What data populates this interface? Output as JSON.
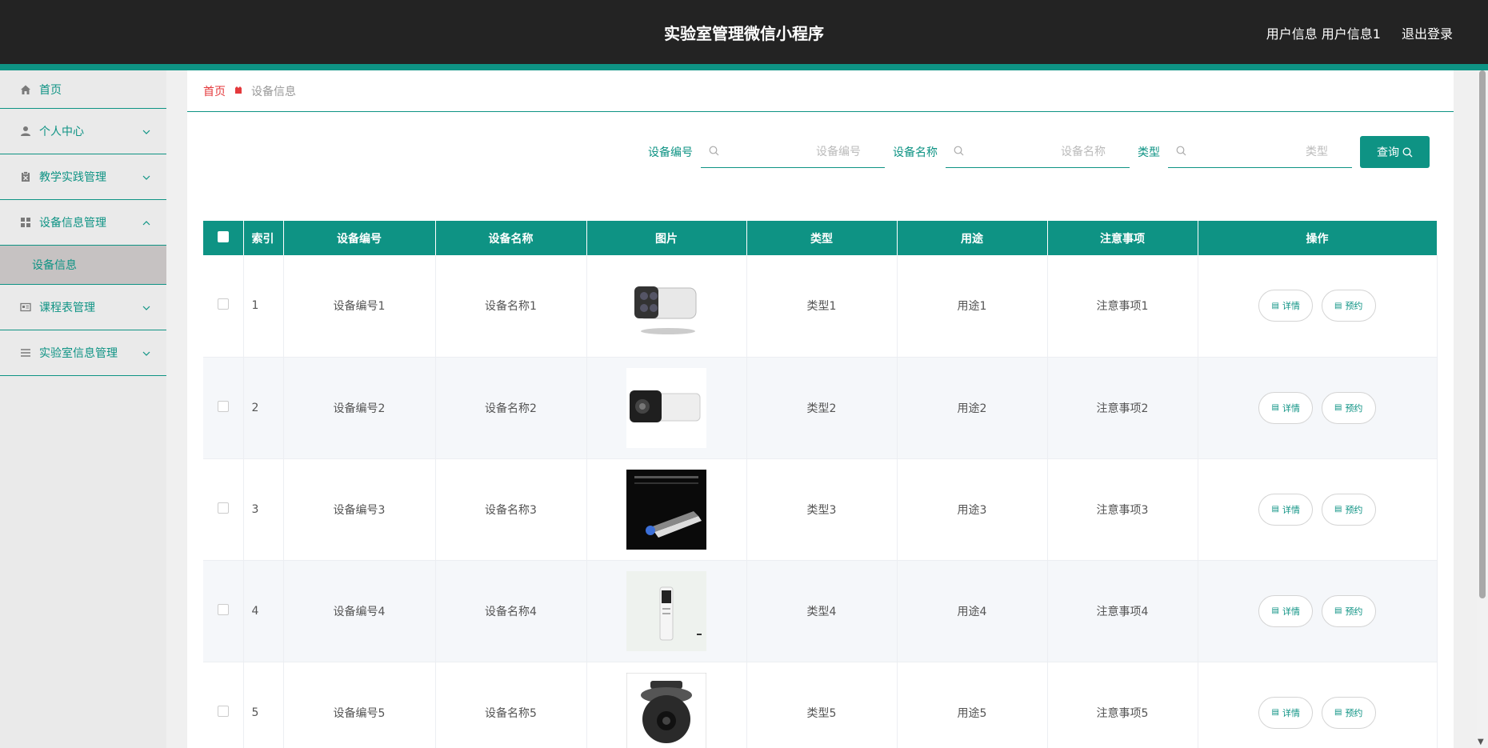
{
  "header": {
    "title": "实验室管理微信小程序",
    "user_info": "用户信息 用户信息1",
    "logout": "退出登录"
  },
  "sidebar": {
    "items": [
      {
        "label": "首页",
        "icon": "home-icon"
      },
      {
        "label": "个人中心",
        "icon": "user-icon"
      },
      {
        "label": "教学实践管理",
        "icon": "clipboard-icon"
      },
      {
        "label": "设备信息管理",
        "icon": "grid-icon"
      },
      {
        "label": "课程表管理",
        "icon": "card-icon"
      },
      {
        "label": "实验室信息管理",
        "icon": "list-icon"
      }
    ],
    "subitem": "设备信息"
  },
  "breadcrumb": {
    "home": "首页",
    "current": "设备信息"
  },
  "search": {
    "field1_label": "设备编号",
    "field1_placeholder": "设备编号",
    "field2_label": "设备名称",
    "field2_placeholder": "设备名称",
    "field3_label": "类型",
    "field3_placeholder": "类型",
    "button": "查询"
  },
  "table": {
    "headers": [
      "索引",
      "设备编号",
      "设备名称",
      "图片",
      "类型",
      "用途",
      "注意事项",
      "操作"
    ],
    "rows": [
      {
        "index": "1",
        "code": "设备编号1",
        "name": "设备名称1",
        "type": "类型1",
        "use": "用途1",
        "note": "注意事项1"
      },
      {
        "index": "2",
        "code": "设备编号2",
        "name": "设备名称2",
        "type": "类型2",
        "use": "用途2",
        "note": "注意事项2"
      },
      {
        "index": "3",
        "code": "设备编号3",
        "name": "设备名称3",
        "type": "类型3",
        "use": "用途3",
        "note": "注意事项3"
      },
      {
        "index": "4",
        "code": "设备编号4",
        "name": "设备名称4",
        "type": "类型4",
        "use": "用途4",
        "note": "注意事项4"
      },
      {
        "index": "5",
        "code": "设备编号5",
        "name": "设备名称5",
        "type": "类型5",
        "use": "用途5",
        "note": "注意事项5"
      }
    ],
    "detail_label": "详情",
    "reserve_label": "预约"
  },
  "colors": {
    "accent": "#0e9384",
    "header_bg": "#232323",
    "breadcrumb_home": "#e4393c"
  }
}
